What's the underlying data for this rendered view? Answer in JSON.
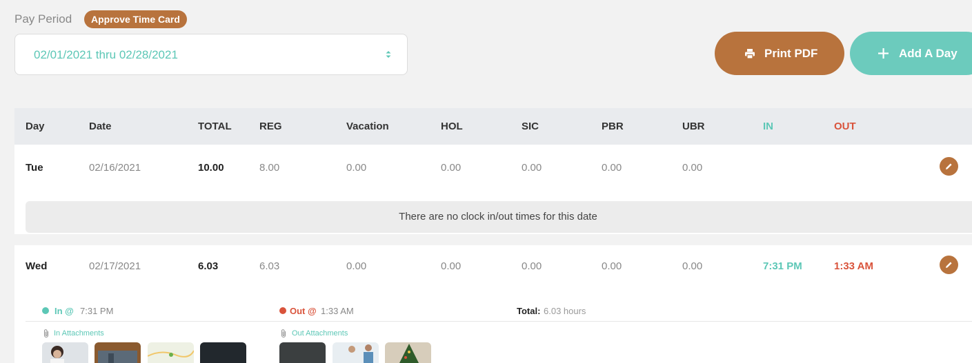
{
  "header": {
    "pay_period_label": "Pay Period",
    "approve_label": "Approve Time Card",
    "period_value": "02/01/2021 thru 02/28/2021",
    "print_label": "Print PDF",
    "add_day_label": "Add A Day"
  },
  "colors": {
    "accent_brown": "#b8733d",
    "accent_teal": "#5cc7b6",
    "out_red": "#d9533b"
  },
  "table": {
    "columns": [
      "Day",
      "Date",
      "TOTAL",
      "REG",
      "Vacation",
      "HOL",
      "SIC",
      "PBR",
      "UBR",
      "IN",
      "OUT"
    ],
    "rows": [
      {
        "day": "Tue",
        "date": "02/16/2021",
        "total": "10.00",
        "reg": "8.00",
        "vacation": "0.00",
        "hol": "0.00",
        "sic": "0.00",
        "pbr": "0.00",
        "ubr": "0.00",
        "in": "",
        "out": "",
        "no_times": "There are no clock in/out times for this date"
      },
      {
        "day": "Wed",
        "date": "02/17/2021",
        "total": "6.03",
        "reg": "6.03",
        "vacation": "0.00",
        "hol": "0.00",
        "sic": "0.00",
        "pbr": "0.00",
        "ubr": "0.00",
        "in": "7:31 PM",
        "out": "1:33 AM",
        "detail": {
          "in_label": "In @",
          "in_time": "7:31 PM",
          "out_label": "Out @",
          "out_time": "1:33 AM",
          "total_label": "Total:",
          "total_value": "6.03 hours",
          "in_attachments_label": "In Attachments",
          "out_attachments_label": "Out Attachments"
        }
      }
    ]
  },
  "icons": [
    "printer-icon",
    "plus-icon",
    "pencil-icon",
    "paperclip-icon",
    "select-arrows-icon"
  ]
}
